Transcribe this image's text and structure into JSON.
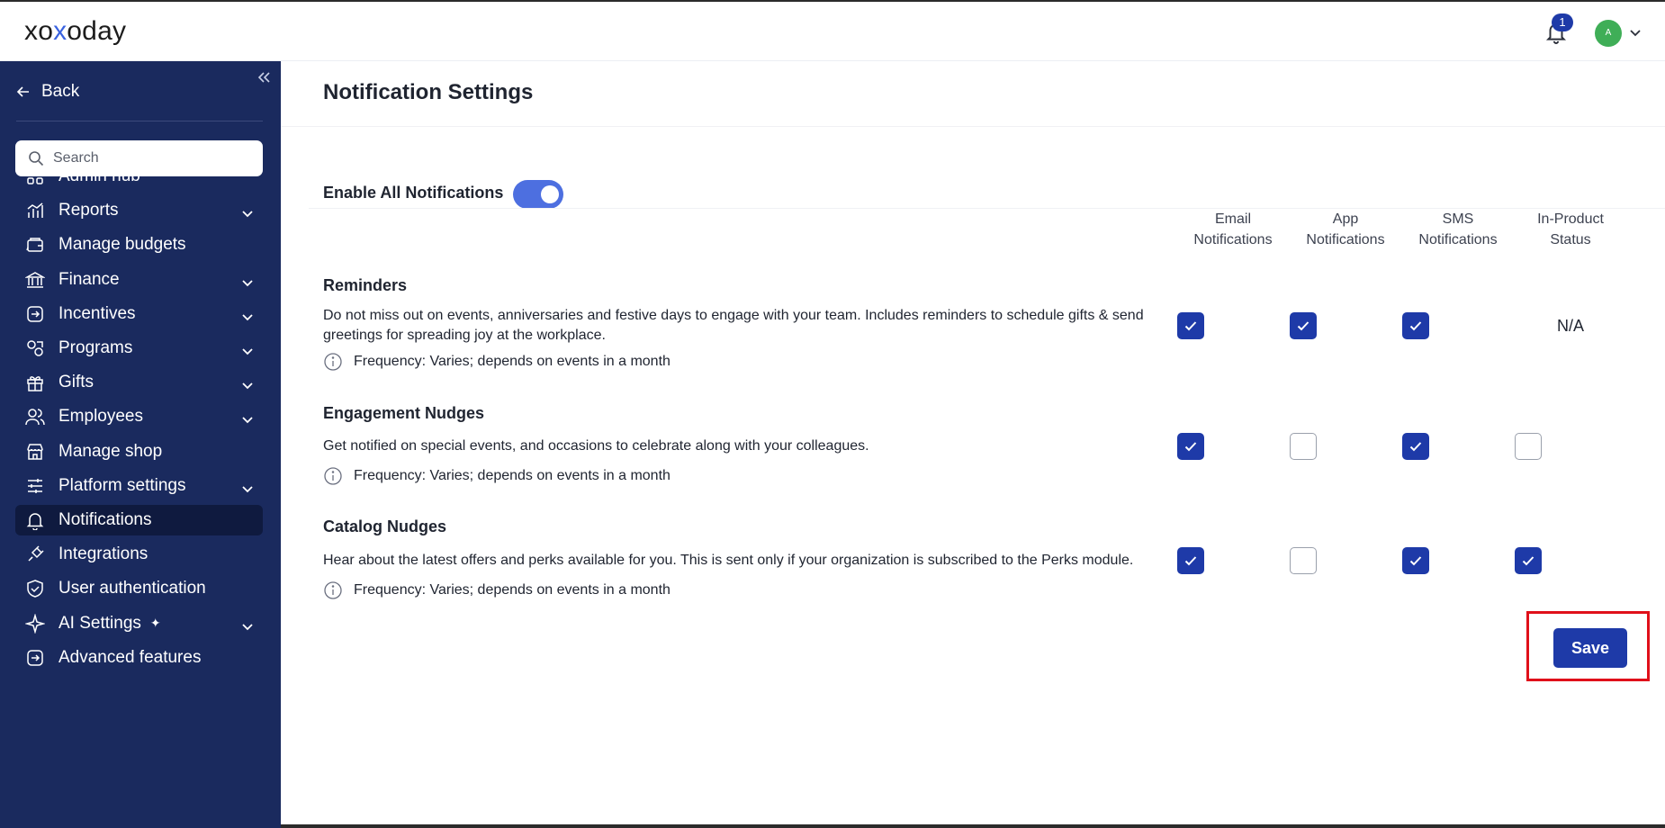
{
  "header": {
    "logo_pre": "xo",
    "logo_x": "x",
    "logo_post": "oday",
    "notification_count": "1",
    "avatar_initial": "A"
  },
  "sidebar": {
    "back_label": "Back",
    "search_placeholder": "Search",
    "items": [
      {
        "label": "Admin hub",
        "icon": "grid-icon",
        "has_chevron": false
      },
      {
        "label": "Reports",
        "icon": "bar-chart-icon",
        "has_chevron": true
      },
      {
        "label": "Manage budgets",
        "icon": "wallet-icon",
        "has_chevron": false
      },
      {
        "label": "Finance",
        "icon": "bank-icon",
        "has_chevron": true
      },
      {
        "label": "Incentives",
        "icon": "incentive-icon",
        "has_chevron": true
      },
      {
        "label": "Programs",
        "icon": "programs-icon",
        "has_chevron": true
      },
      {
        "label": "Gifts",
        "icon": "gift-icon",
        "has_chevron": true
      },
      {
        "label": "Employees",
        "icon": "users-icon",
        "has_chevron": true
      },
      {
        "label": "Manage shop",
        "icon": "shop-icon",
        "has_chevron": false
      },
      {
        "label": "Platform settings",
        "icon": "sliders-icon",
        "has_chevron": true
      },
      {
        "label": "Notifications",
        "icon": "bell-icon",
        "has_chevron": false,
        "active": true
      },
      {
        "label": "Integrations",
        "icon": "plug-icon",
        "has_chevron": false
      },
      {
        "label": "User authentication",
        "icon": "shield-icon",
        "has_chevron": false
      },
      {
        "label": "AI Settings",
        "icon": "sparkle-icon",
        "has_chevron": true
      },
      {
        "label": "Advanced features",
        "icon": "advanced-icon",
        "has_chevron": false
      }
    ]
  },
  "main": {
    "title": "Notification Settings",
    "enable_all_label": "Enable All Notifications",
    "enable_all_on": true,
    "columns": [
      {
        "line1": "Email",
        "line2": "Notifications"
      },
      {
        "line1": "App",
        "line2": "Notifications"
      },
      {
        "line1": "SMS",
        "line2": "Notifications"
      },
      {
        "line1": "In-Product",
        "line2": "Status"
      }
    ],
    "sections": [
      {
        "title": "Reminders",
        "description": "Do not miss out on events, anniversaries and festive days to engage with your team. Includes reminders to schedule gifts & send greetings for spreading joy at the workplace.",
        "frequency": "Frequency: Varies; depends on events in a month",
        "email": true,
        "app": true,
        "sms": true,
        "in_product": "N/A"
      },
      {
        "title": "Engagement Nudges",
        "description": "Get notified on special events, and occasions to celebrate along with your colleagues.",
        "frequency": "Frequency: Varies; depends on events in a month",
        "email": true,
        "app": false,
        "sms": true,
        "in_product": false
      },
      {
        "title": "Catalog Nudges",
        "description": "Hear about the latest offers and perks available for you. This is sent only if your organization is subscribed to the Perks module.",
        "frequency": "Frequency: Varies; depends on events in a month",
        "email": true,
        "app": false,
        "sms": true,
        "in_product": true
      }
    ],
    "save_label": "Save"
  },
  "colors": {
    "sidebar_bg": "#1a2a5e",
    "accent": "#1e3aa8",
    "toggle": "#4d6fe0",
    "highlight": "#e0101a"
  }
}
